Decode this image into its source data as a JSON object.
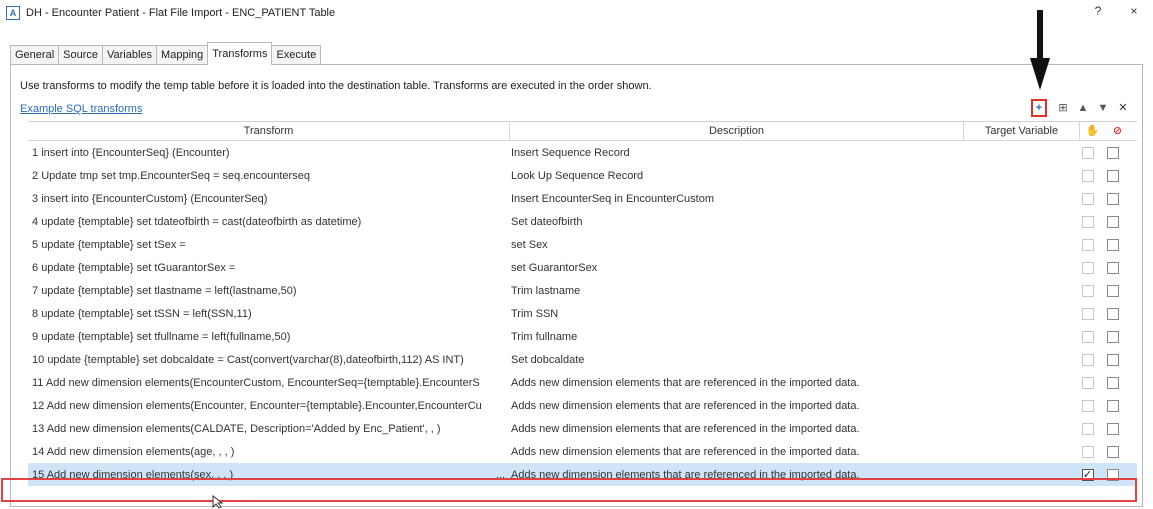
{
  "window": {
    "app_icon": "A",
    "title": "DH - Encounter Patient - Flat File Import - ENC_PATIENT Table",
    "help_label": "?",
    "close_label": "×"
  },
  "tabs": [
    {
      "label": "General"
    },
    {
      "label": "Source"
    },
    {
      "label": "Variables"
    },
    {
      "label": "Mapping"
    },
    {
      "label": "Transforms",
      "active": true
    },
    {
      "label": "Execute"
    }
  ],
  "intro_text": "Use transforms to modify the temp table before it is loaded into the destination table. Transforms are executed in the order shown.",
  "example_link": "Example SQL transforms",
  "toolbar": {
    "add_icon": "+",
    "edit_icon": "⊞",
    "up_icon": "▲",
    "down_icon": "▼",
    "delete_icon": "✕"
  },
  "columns": {
    "transform": "Transform",
    "description": "Description",
    "target_variable": "Target Variable",
    "hand_icon": "✋",
    "disable_icon": "⊘"
  },
  "rows": [
    {
      "num": "1",
      "transform": "insert into {EncounterSeq} (Encounter)",
      "description": "Insert Sequence Record",
      "checked1": false,
      "checked2": false
    },
    {
      "num": "2",
      "transform": "Update tmp set tmp.EncounterSeq = seq.encounterseq",
      "description": "Look Up Sequence Record",
      "checked1": false,
      "checked2": false
    },
    {
      "num": "3",
      "transform": "insert into {EncounterCustom} (EncounterSeq)",
      "description": "Insert EncounterSeq in EncounterCustom",
      "checked1": false,
      "checked2": false
    },
    {
      "num": "4",
      "transform": "update {temptable} set tdateofbirth = cast(dateofbirth as datetime)",
      "description": "Set dateofbirth",
      "checked1": false,
      "checked2": false
    },
    {
      "num": "5",
      "transform": "update {temptable} set tSex =",
      "description": "set Sex",
      "checked1": false,
      "checked2": false
    },
    {
      "num": "6",
      "transform": "update {temptable} set tGuarantorSex =",
      "description": "set GuarantorSex",
      "checked1": false,
      "checked2": false
    },
    {
      "num": "7",
      "transform": "update {temptable} set tlastname = left(lastname,50)",
      "description": "Trim lastname",
      "checked1": false,
      "checked2": false
    },
    {
      "num": "8",
      "transform": "update {temptable} set tSSN = left(SSN,11)",
      "description": "Trim SSN",
      "checked1": false,
      "checked2": false
    },
    {
      "num": "9",
      "transform": "update {temptable} set tfullname = left(fullname,50)",
      "description": "Trim fullname",
      "checked1": false,
      "checked2": false
    },
    {
      "num": "10",
      "transform": "update {temptable} set dobcaldate = Cast(convert(varchar(8),dateofbirth,112) AS INT)",
      "description": "Set dobcaldate",
      "checked1": false,
      "checked2": false
    },
    {
      "num": "11",
      "transform": "Add new dimension elements(EncounterCustom, EncounterSeq={temptable}.EncounterS",
      "description": "Adds new dimension elements that are referenced in the imported data.",
      "checked1": false,
      "checked2": false
    },
    {
      "num": "12",
      "transform": "Add new dimension elements(Encounter, Encounter={temptable}.Encounter,EncounterCu",
      "description": "Adds new dimension elements that are referenced in the imported data.",
      "checked1": false,
      "checked2": false
    },
    {
      "num": "13",
      "transform": "Add new dimension elements(CALDATE, Description='Added by Enc_Patient', , )",
      "description": "Adds new dimension elements that are referenced in the imported data.",
      "checked1": false,
      "checked2": false
    },
    {
      "num": "14",
      "transform": "Add new dimension elements(age, , , )",
      "description": "Adds new dimension elements that are referenced in the imported data.",
      "checked1": false,
      "checked2": false
    },
    {
      "num": "15",
      "transform": "Add new dimension elements(sex, , , )",
      "description": "Adds new dimension elements that are referenced in the imported data.",
      "checked1": true,
      "checked2": false,
      "selected": true,
      "ellipsis": "..."
    }
  ]
}
